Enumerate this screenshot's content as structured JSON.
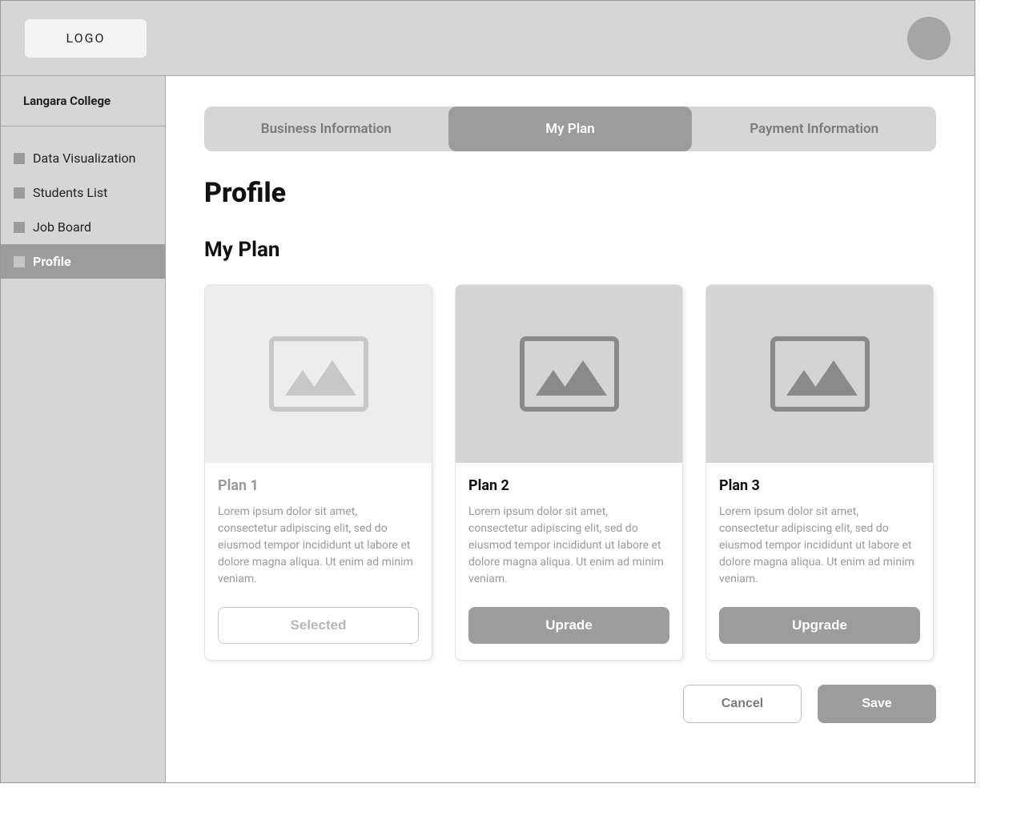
{
  "header": {
    "logo": "LOGO"
  },
  "sidebar": {
    "org": "Langara College",
    "items": [
      {
        "label": "Data Visualization",
        "active": false
      },
      {
        "label": "Students List",
        "active": false
      },
      {
        "label": "Job Board",
        "active": false
      },
      {
        "label": "Profile",
        "active": true
      }
    ]
  },
  "tabs": [
    {
      "label": "Business Information",
      "active": false
    },
    {
      "label": "My Plan",
      "active": true
    },
    {
      "label": "Payment Information",
      "active": false
    }
  ],
  "page": {
    "title": "Profile",
    "section": "My Plan"
  },
  "plans": [
    {
      "title": "Plan 1",
      "desc": "Lorem ipsum dolor sit amet, consectetur adipiscing elit, sed do eiusmod tempor incididunt ut labore et dolore magna aliqua. Ut enim ad minim veniam.",
      "button": "Selected",
      "selected": true
    },
    {
      "title": "Plan 2",
      "desc": "Lorem ipsum dolor sit amet, consectetur adipiscing elit, sed do eiusmod tempor incididunt ut labore et dolore magna aliqua. Ut enim ad minim veniam.",
      "button": "Uprade",
      "selected": false
    },
    {
      "title": "Plan 3",
      "desc": "Lorem ipsum dolor sit amet, consectetur adipiscing elit, sed do eiusmod tempor incididunt ut labore et dolore magna aliqua. Ut enim ad minim veniam.",
      "button": "Upgrade",
      "selected": false
    }
  ],
  "actions": {
    "cancel": "Cancel",
    "save": "Save"
  }
}
